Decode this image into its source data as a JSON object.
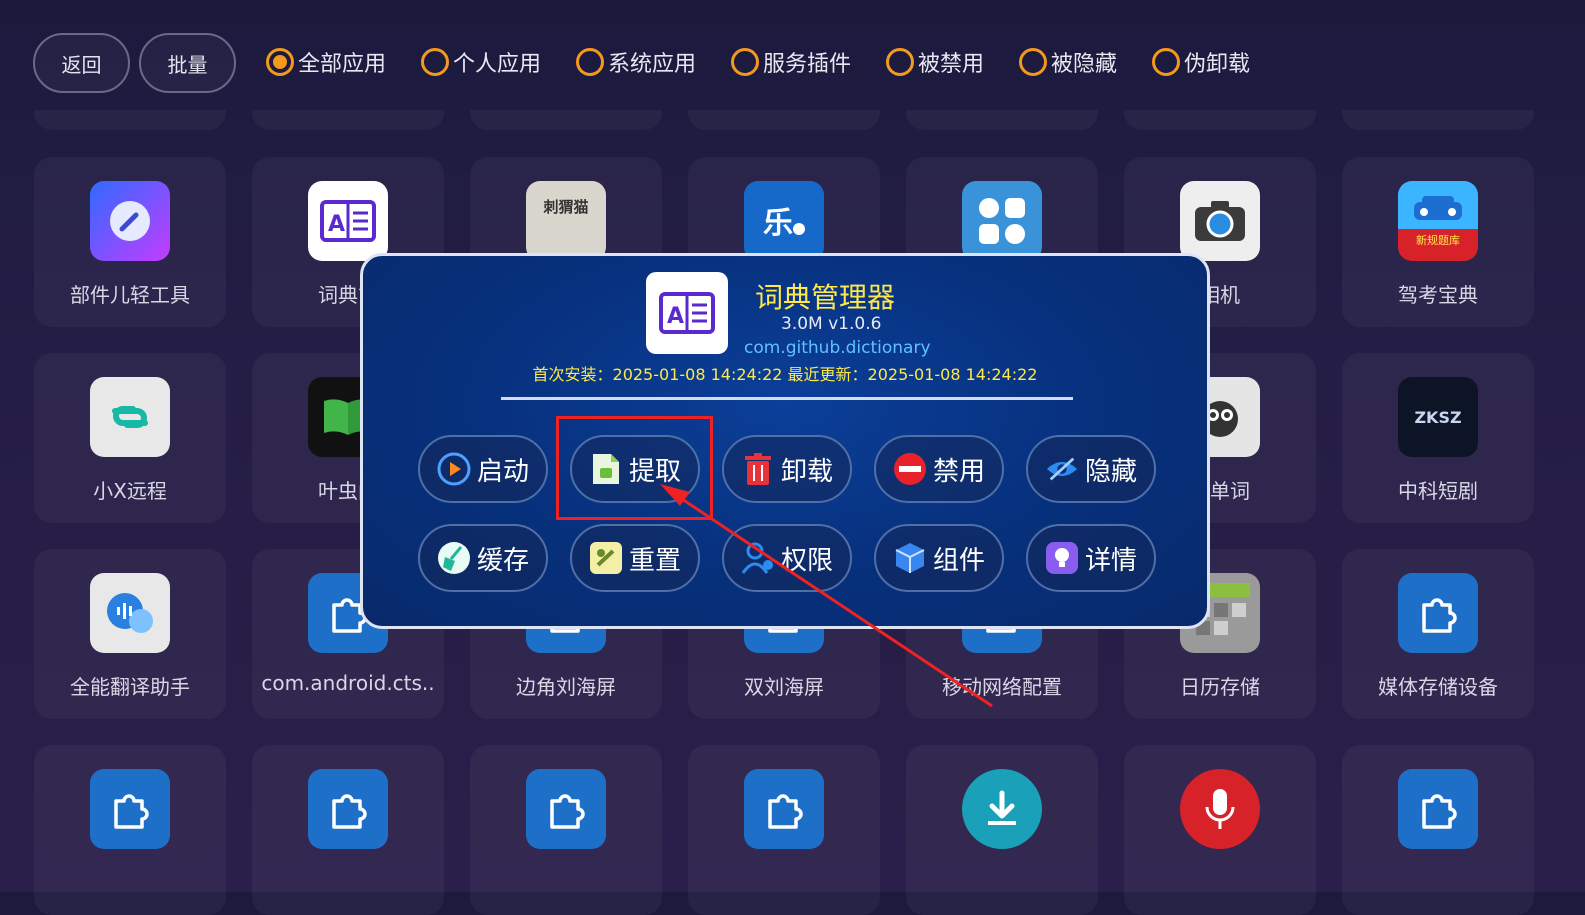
{
  "topbar": {
    "back_label": "返回",
    "batch_label": "批量",
    "filters": [
      "全部应用",
      "个人应用",
      "系统应用",
      "服务插件",
      "被禁用",
      "被隐藏",
      "伪卸载"
    ],
    "selected_filter": "全部应用"
  },
  "grid": {
    "row1": [
      "部件儿轻工具",
      "词典管",
      "",
      "",
      "",
      "相机",
      "驾考宝典"
    ],
    "row2": [
      "小X远程",
      "叶虫阅",
      "",
      "",
      "",
      "背单词",
      "中科短剧"
    ],
    "row3": [
      "全能翻译助手",
      "com.android.cts..",
      "边角刘海屏",
      "双刘海屏",
      "移动网络配置",
      "日历存储",
      "媒体存储设备"
    ]
  },
  "dialog": {
    "app_name": "词典管理器",
    "size_version": "3.0M  v1.0.6",
    "package": "com.github.dictionary",
    "dates": "首次安装：2025-01-08 14:24:22    最近更新：2025-01-08 14:24:22",
    "actions_row1": [
      "启动",
      "提取",
      "卸载",
      "禁用",
      "隐藏"
    ],
    "actions_row2": [
      "缓存",
      "重置",
      "权限",
      "组件",
      "详情"
    ]
  },
  "icons": {
    "jiakao_text": "新规题库",
    "zksz_text": "ZKSZ",
    "cijiao_text": "刺猬猫"
  },
  "colors": {
    "accent_orange": "#f39a1c",
    "dialog_title": "#ffe84a",
    "package_blue": "#5fc2ff",
    "highlight_red": "#ee2222"
  }
}
